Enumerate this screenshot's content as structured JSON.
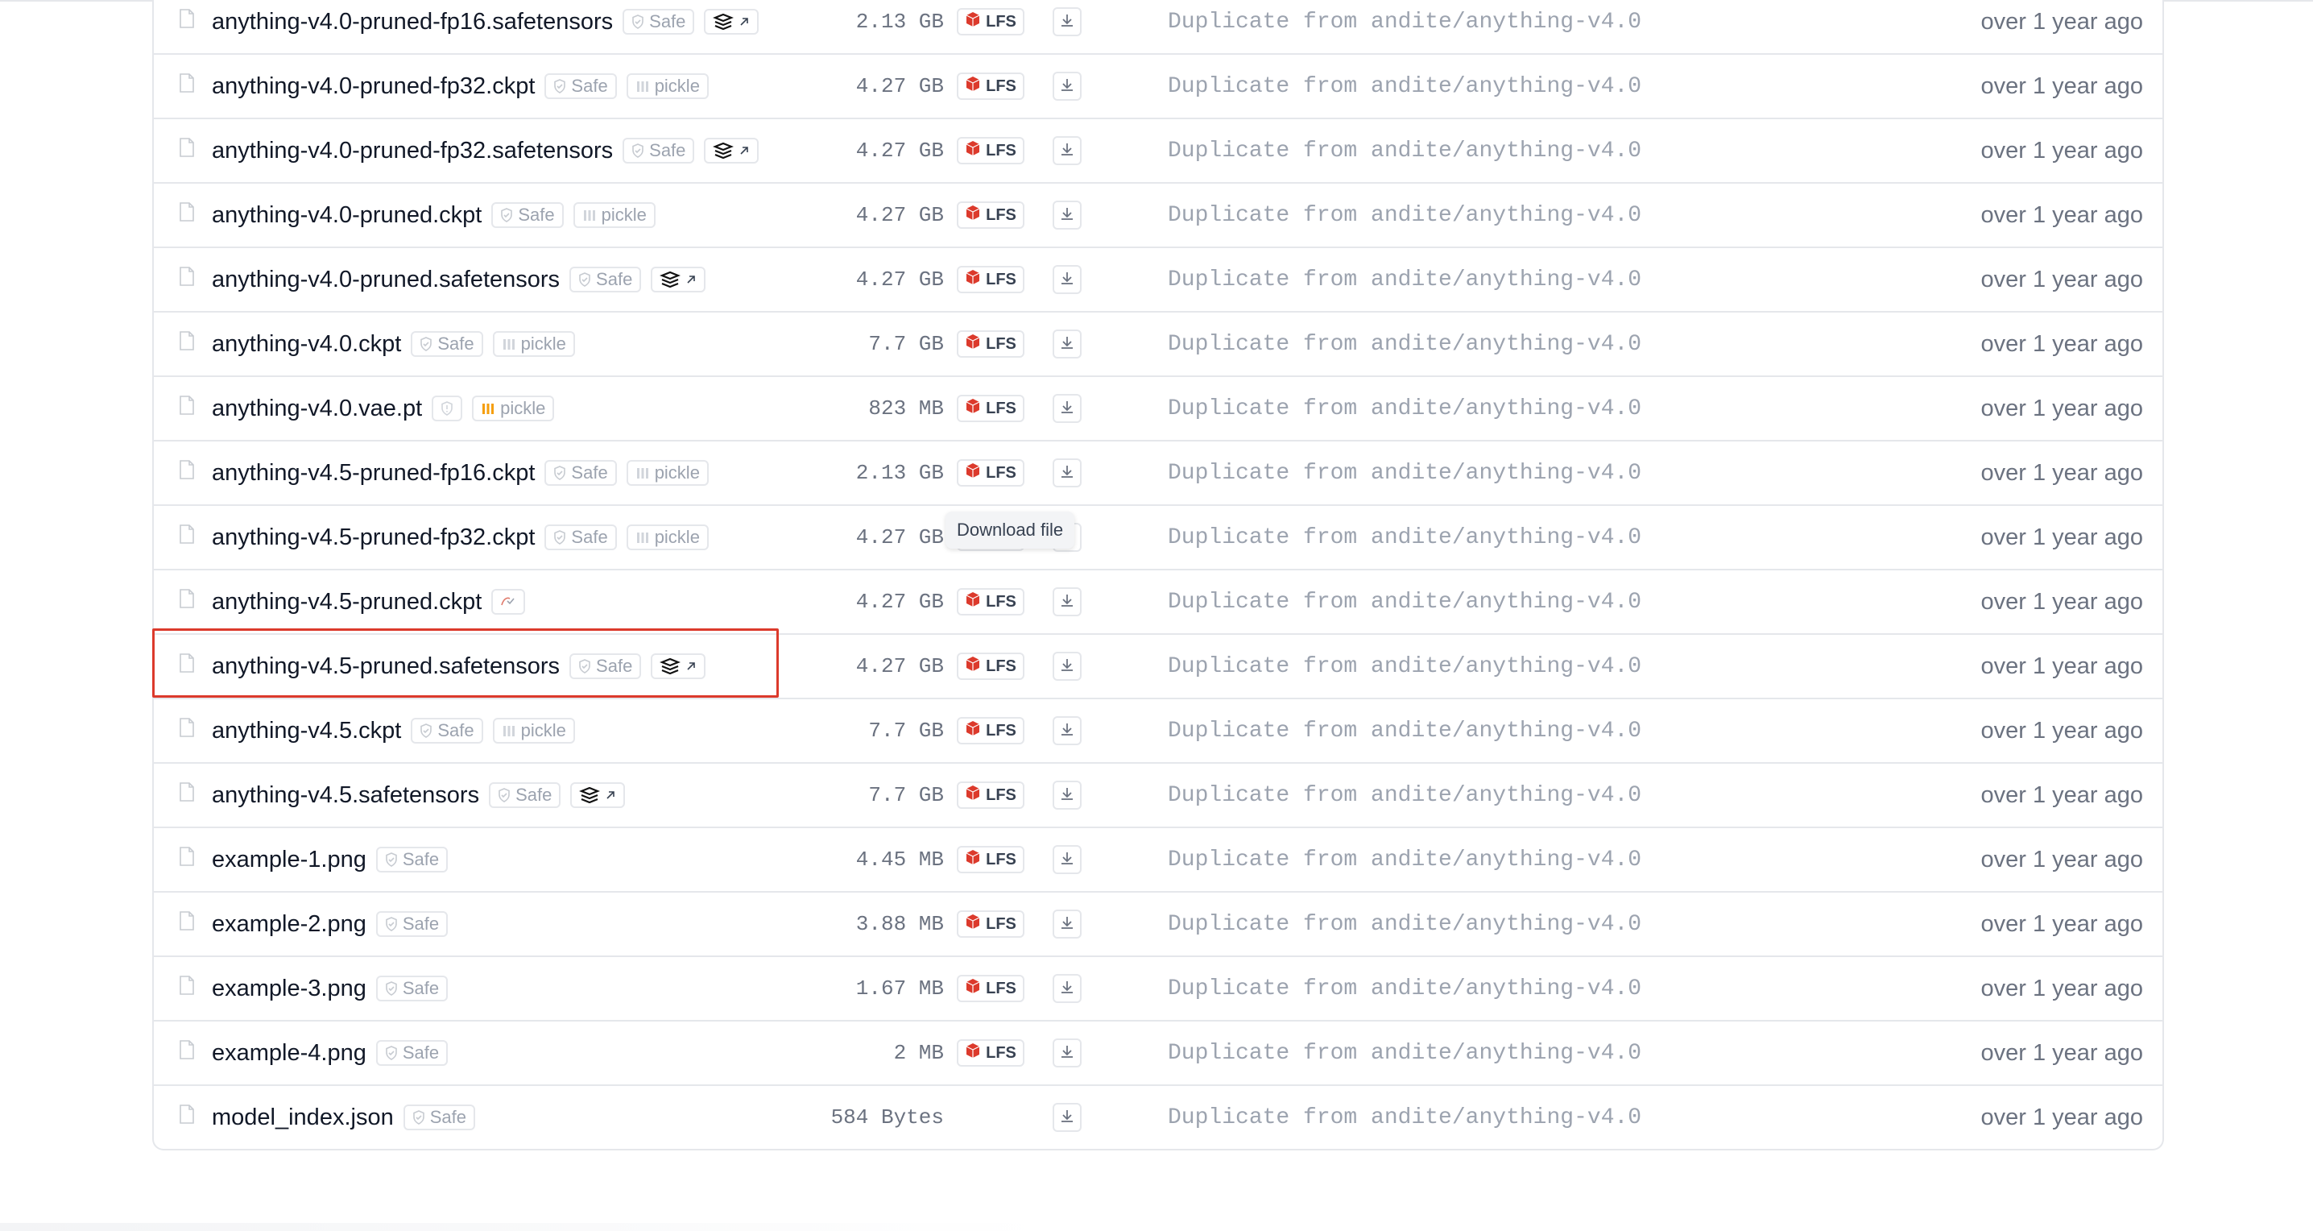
{
  "files": [
    {
      "name": "anything-v4.0-pruned-fp16.safetensors",
      "badges": [
        "safe",
        "safetensors"
      ],
      "size": "2.13 GB",
      "lfs": true,
      "commit": "Duplicate from andite/anything-v4.0",
      "date": "over 1 year ago"
    },
    {
      "name": "anything-v4.0-pruned-fp32.ckpt",
      "badges": [
        "safe",
        "pickle"
      ],
      "size": "4.27 GB",
      "lfs": true,
      "commit": "Duplicate from andite/anything-v4.0",
      "date": "over 1 year ago"
    },
    {
      "name": "anything-v4.0-pruned-fp32.safetensors",
      "badges": [
        "safe",
        "safetensors"
      ],
      "size": "4.27 GB",
      "lfs": true,
      "commit": "Duplicate from andite/anything-v4.0",
      "date": "over 1 year ago"
    },
    {
      "name": "anything-v4.0-pruned.ckpt",
      "badges": [
        "safe",
        "pickle"
      ],
      "size": "4.27 GB",
      "lfs": true,
      "commit": "Duplicate from andite/anything-v4.0",
      "date": "over 1 year ago"
    },
    {
      "name": "anything-v4.0-pruned.safetensors",
      "badges": [
        "safe",
        "safetensors"
      ],
      "size": "4.27 GB",
      "lfs": true,
      "commit": "Duplicate from andite/anything-v4.0",
      "date": "over 1 year ago"
    },
    {
      "name": "anything-v4.0.ckpt",
      "badges": [
        "safe",
        "pickle"
      ],
      "size": "7.7 GB",
      "lfs": true,
      "commit": "Duplicate from andite/anything-v4.0",
      "date": "over 1 year ago"
    },
    {
      "name": "anything-v4.0.vae.pt",
      "badges": [
        "info",
        "pickle-warn"
      ],
      "size": "823 MB",
      "lfs": true,
      "commit": "Duplicate from andite/anything-v4.0",
      "date": "over 1 year ago"
    },
    {
      "name": "anything-v4.5-pruned-fp16.ckpt",
      "badges": [
        "safe",
        "pickle"
      ],
      "size": "2.13 GB",
      "lfs": true,
      "commit": "Duplicate from andite/anything-v4.0",
      "date": "over 1 year ago"
    },
    {
      "name": "anything-v4.5-pruned-fp32.ckpt",
      "badges": [
        "safe",
        "pickle"
      ],
      "size": "4.27 GB",
      "lfs": true,
      "commit": "Duplicate from andite/anything-v4.0",
      "date": "over 1 year ago"
    },
    {
      "name": "anything-v4.5-pruned.ckpt",
      "badges": [
        "scan-pending"
      ],
      "size": "4.27 GB",
      "lfs": true,
      "commit": "Duplicate from andite/anything-v4.0",
      "date": "over 1 year ago"
    },
    {
      "name": "anything-v4.5-pruned.safetensors",
      "badges": [
        "safe",
        "safetensors"
      ],
      "size": "4.27 GB",
      "lfs": true,
      "commit": "Duplicate from andite/anything-v4.0",
      "date": "over 1 year ago"
    },
    {
      "name": "anything-v4.5.ckpt",
      "badges": [
        "safe",
        "pickle"
      ],
      "size": "7.7 GB",
      "lfs": true,
      "commit": "Duplicate from andite/anything-v4.0",
      "date": "over 1 year ago"
    },
    {
      "name": "anything-v4.5.safetensors",
      "badges": [
        "safe",
        "safetensors"
      ],
      "size": "7.7 GB",
      "lfs": true,
      "commit": "Duplicate from andite/anything-v4.0",
      "date": "over 1 year ago"
    },
    {
      "name": "example-1.png",
      "badges": [
        "safe"
      ],
      "size": "4.45 MB",
      "lfs": true,
      "commit": "Duplicate from andite/anything-v4.0",
      "date": "over 1 year ago"
    },
    {
      "name": "example-2.png",
      "badges": [
        "safe"
      ],
      "size": "3.88 MB",
      "lfs": true,
      "commit": "Duplicate from andite/anything-v4.0",
      "date": "over 1 year ago"
    },
    {
      "name": "example-3.png",
      "badges": [
        "safe"
      ],
      "size": "1.67 MB",
      "lfs": true,
      "commit": "Duplicate from andite/anything-v4.0",
      "date": "over 1 year ago"
    },
    {
      "name": "example-4.png",
      "badges": [
        "safe"
      ],
      "size": "2 MB",
      "lfs": true,
      "commit": "Duplicate from andite/anything-v4.0",
      "date": "over 1 year ago"
    },
    {
      "name": "model_index.json",
      "badges": [
        "safe"
      ],
      "size": "584 Bytes",
      "lfs": false,
      "commit": "Duplicate from andite/anything-v4.0",
      "date": "over 1 year ago"
    }
  ],
  "labels": {
    "safe": "Safe",
    "pickle": "pickle",
    "lfs": "LFS"
  },
  "tooltip": {
    "text": "Download file",
    "row": 8
  },
  "highlight": {
    "row": 10
  },
  "colors": {
    "lfs_red": "#dc3a2c",
    "pickle_orange": "#f59e0b",
    "highlight_border": "#dc3a2c",
    "border": "#e5e7eb",
    "muted_text": "#9ca3af"
  },
  "icons": {
    "file": "file-icon",
    "safe": "shield-check-icon",
    "pickle": "pickle-icon",
    "safetensors": "safetensors-logo-icon",
    "external": "external-link-icon",
    "lfs": "lfs-cube-icon",
    "download": "download-icon"
  }
}
